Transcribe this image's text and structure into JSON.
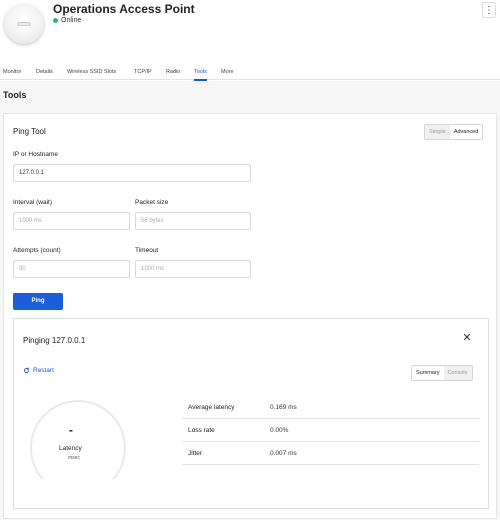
{
  "header": {
    "title": "Operations Access Point",
    "status": "Online",
    "status_color": "#2fb577",
    "menu_icon": "kebab-icon"
  },
  "tabs": [
    {
      "label": "Monitor"
    },
    {
      "label": "Details"
    },
    {
      "label": "Wireless SSID Slots"
    },
    {
      "label": "TCP/IP"
    },
    {
      "label": "Radio"
    },
    {
      "label": "Tools",
      "active": true
    },
    {
      "label": "More"
    }
  ],
  "page_title": "Tools",
  "ping_tool": {
    "title": "Ping Tool",
    "mode_options": [
      "Simple",
      "Advanced"
    ],
    "mode_selected": "Advanced",
    "host_label": "IP or Hostname",
    "host_value": "127.0.0.1",
    "interval_label": "Interval (wait)",
    "interval_placeholder": "1000 ms",
    "packet_label": "Packet size",
    "packet_placeholder": "56 bytes",
    "attempts_label": "Attempts (count)",
    "attempts_placeholder": "30",
    "timeout_label": "Timeout",
    "timeout_placeholder": "1000 ms",
    "ping_button": "Ping"
  },
  "result": {
    "title": "Pinging 127.0.0.1",
    "restart_label": "Restart",
    "view_options": [
      "Summary",
      "Console"
    ],
    "view_selected": "Summary",
    "gauge_value": "-",
    "gauge_label": "Latency",
    "gauge_unit": "msec",
    "stats": [
      {
        "key": "Average latency",
        "value": "0.169 ms"
      },
      {
        "key": "Loss rate",
        "value": "0.00%"
      },
      {
        "key": "Jitter",
        "value": "0.007 ms"
      }
    ]
  },
  "colors": {
    "accent": "#1a57d6",
    "button": "#1a5fd9",
    "online": "#2fb577"
  }
}
